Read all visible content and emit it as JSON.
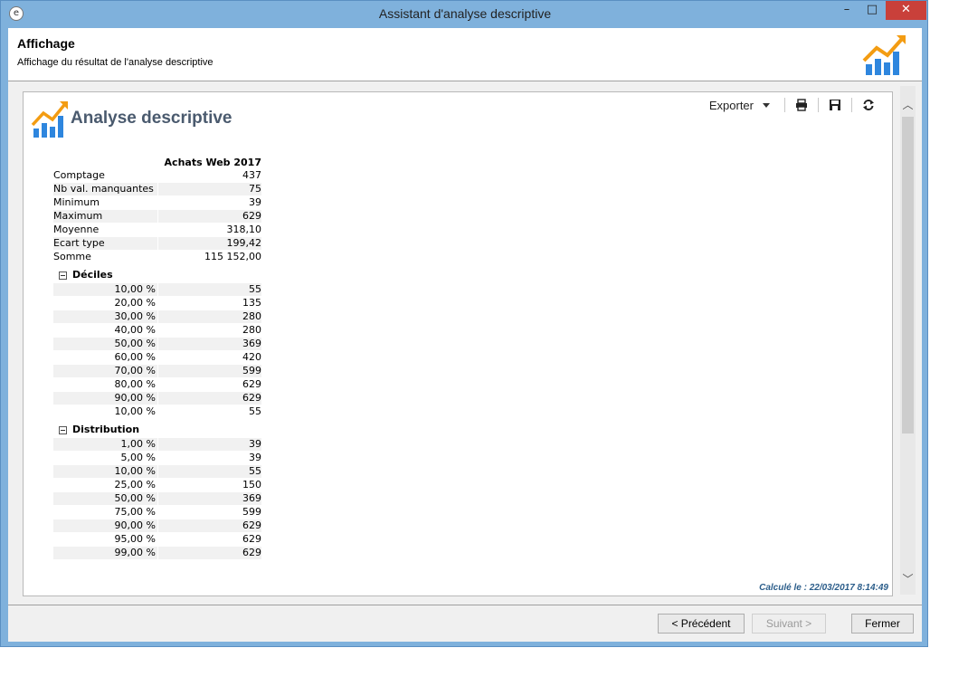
{
  "window": {
    "title": "Assistant d'analyse descriptive",
    "minimize": "–",
    "maximize": "□",
    "close": "✕"
  },
  "header": {
    "title": "Affichage",
    "subtitle": "Affichage du résultat de l'analyse descriptive"
  },
  "report": {
    "title": "Analyse descriptive",
    "toolbar": {
      "export_label": "Exporter"
    },
    "column_header": "Achats Web 2017",
    "summary": [
      {
        "label": "Comptage",
        "value": "437"
      },
      {
        "label": "Nb val. manquantes",
        "value": "75"
      },
      {
        "label": "Minimum",
        "value": "39"
      },
      {
        "label": "Maximum",
        "value": "629"
      },
      {
        "label": "Moyenne",
        "value": "318,10"
      },
      {
        "label": "Ecart type",
        "value": "199,42"
      },
      {
        "label": "Somme",
        "value": "115 152,00"
      }
    ],
    "groups": [
      {
        "name": "Déciles",
        "rows": [
          {
            "label": "10,00 %",
            "value": "55"
          },
          {
            "label": "20,00 %",
            "value": "135"
          },
          {
            "label": "30,00 %",
            "value": "280"
          },
          {
            "label": "40,00 %",
            "value": "280"
          },
          {
            "label": "50,00 %",
            "value": "369"
          },
          {
            "label": "60,00 %",
            "value": "420"
          },
          {
            "label": "70,00 %",
            "value": "599"
          },
          {
            "label": "80,00 %",
            "value": "629"
          },
          {
            "label": "90,00 %",
            "value": "629"
          },
          {
            "label": "10,00 %",
            "value": "55"
          }
        ]
      },
      {
        "name": "Distribution",
        "rows": [
          {
            "label": "1,00 %",
            "value": "39"
          },
          {
            "label": "5,00 %",
            "value": "39"
          },
          {
            "label": "10,00 %",
            "value": "55"
          },
          {
            "label": "25,00 %",
            "value": "150"
          },
          {
            "label": "50,00 %",
            "value": "369"
          },
          {
            "label": "75,00 %",
            "value": "599"
          },
          {
            "label": "90,00 %",
            "value": "629"
          },
          {
            "label": "95,00 %",
            "value": "629"
          },
          {
            "label": "99,00 %",
            "value": "629"
          }
        ]
      }
    ],
    "computed": "Calculé le : 22/03/2017 8:14:49"
  },
  "buttons": {
    "previous": "< Précédent",
    "next": "Suivant >",
    "close": "Fermer"
  },
  "icons": [
    "app-icon",
    "chart-logo-icon",
    "dropdown-caret-icon",
    "print-icon",
    "save-icon",
    "refresh-icon",
    "collapse-icon",
    "scroll-up-icon",
    "scroll-down-icon"
  ],
  "colors": {
    "accent_orange": "#f39c12",
    "accent_blue": "#2e86de",
    "title_text": "#4a5a6e",
    "computed_text": "#2b5d8a"
  }
}
